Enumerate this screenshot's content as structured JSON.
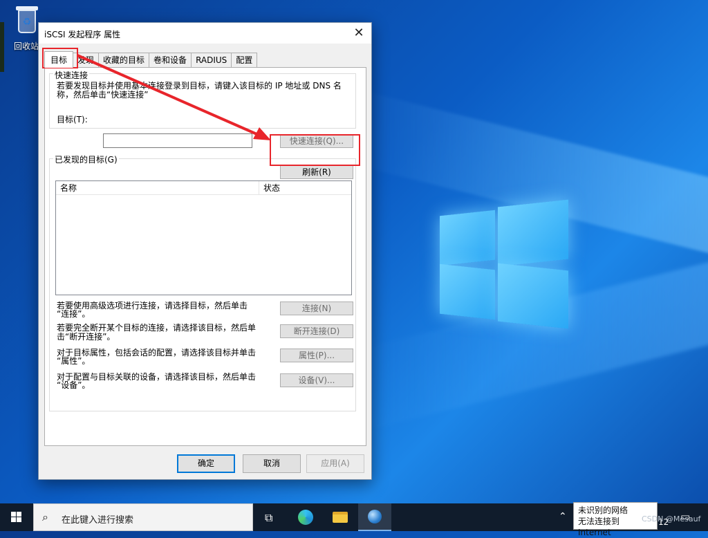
{
  "desktop": {
    "recycle_bin_label": "回收站"
  },
  "dialog": {
    "title": "iSCSI 发起程序 属性",
    "tabs": [
      {
        "label": "目标",
        "active": true
      },
      {
        "label": "发现",
        "active": false
      },
      {
        "label": "收藏的目标",
        "active": false
      },
      {
        "label": "卷和设备",
        "active": false
      },
      {
        "label": "RADIUS",
        "active": false
      },
      {
        "label": "配置",
        "active": false
      }
    ],
    "quick_connect": {
      "group_label": "快速连接",
      "description_line1": "若要发现目标并使用基本连接登录到目标，请键入该目标的 IP 地址或 DNS 名",
      "description_line2": "称，然后单击“快速连接”",
      "target_label": "目标(T):",
      "target_value": "",
      "quick_connect_button": "快速连接(Q)..."
    },
    "discovered": {
      "group_label": "已发现的目标(G)",
      "refresh_button": "刷新(R)",
      "columns": [
        "名称",
        "状态"
      ],
      "rows": []
    },
    "actions": [
      {
        "text_line1": "若要使用高级选项进行连接，请选择目标，然后单击",
        "text_line2": "“连接”。",
        "button": "连接(N)"
      },
      {
        "text_line1": "若要完全断开某个目标的连接，请选择该目标，然后单",
        "text_line2": "击“断开连接”。",
        "button": "断开连接(D)"
      },
      {
        "text_line1": "对于目标属性，包括会话的配置，请选择该目标并单击",
        "text_line2": "“属性”。",
        "button": "属性(P)..."
      },
      {
        "text_line1": "对于配置与目标关联的设备，请选择该目标，然后单击",
        "text_line2": "“设备”。",
        "button": "设备(V)..."
      }
    ],
    "footer": {
      "ok": "确定",
      "cancel": "取消",
      "apply": "应用(A)"
    }
  },
  "taskbar": {
    "search_placeholder": "在此键入进行搜索",
    "network_toast_line1": "未识别的网络",
    "network_toast_line2": "无法连接到 Internet",
    "clock_fragment": "12",
    "watermark": "CSDN @Mesauf"
  },
  "colors": {
    "annotation_red": "#e8252b",
    "accent_blue": "#0078d7"
  }
}
